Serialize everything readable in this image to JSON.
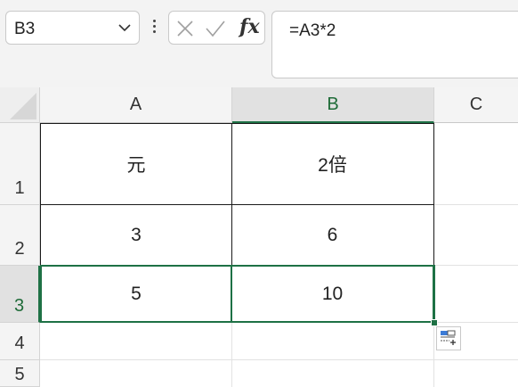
{
  "name_box": {
    "value": "B3",
    "dropdown_icon": "chevron-down-icon"
  },
  "formula_bar": {
    "more_icon": "vertical-ellipsis-icon",
    "cancel_icon": "x-icon",
    "enter_icon": "checkmark-icon",
    "function_label": "fx",
    "formula": "=A3*2"
  },
  "columns": [
    {
      "label": "A",
      "selected": false
    },
    {
      "label": "B",
      "selected": true
    },
    {
      "label": "C",
      "selected": false
    }
  ],
  "rows": [
    {
      "label": "1",
      "cells": [
        "元",
        "2倍",
        ""
      ]
    },
    {
      "label": "2",
      "cells": [
        "3",
        "6",
        ""
      ]
    },
    {
      "label": "3",
      "cells": [
        "5",
        "10",
        ""
      ],
      "selected": true
    },
    {
      "label": "4",
      "cells": [
        "",
        "",
        ""
      ]
    },
    {
      "label": "5",
      "cells": [
        "",
        "",
        ""
      ]
    }
  ],
  "active_cell": "B3",
  "colors": {
    "accent_green": "#1e7145",
    "header_bg": "#f4f4f4",
    "selected_header_bg": "#e1e1e1"
  },
  "quick_analysis_icon": "quick-analysis-icon"
}
